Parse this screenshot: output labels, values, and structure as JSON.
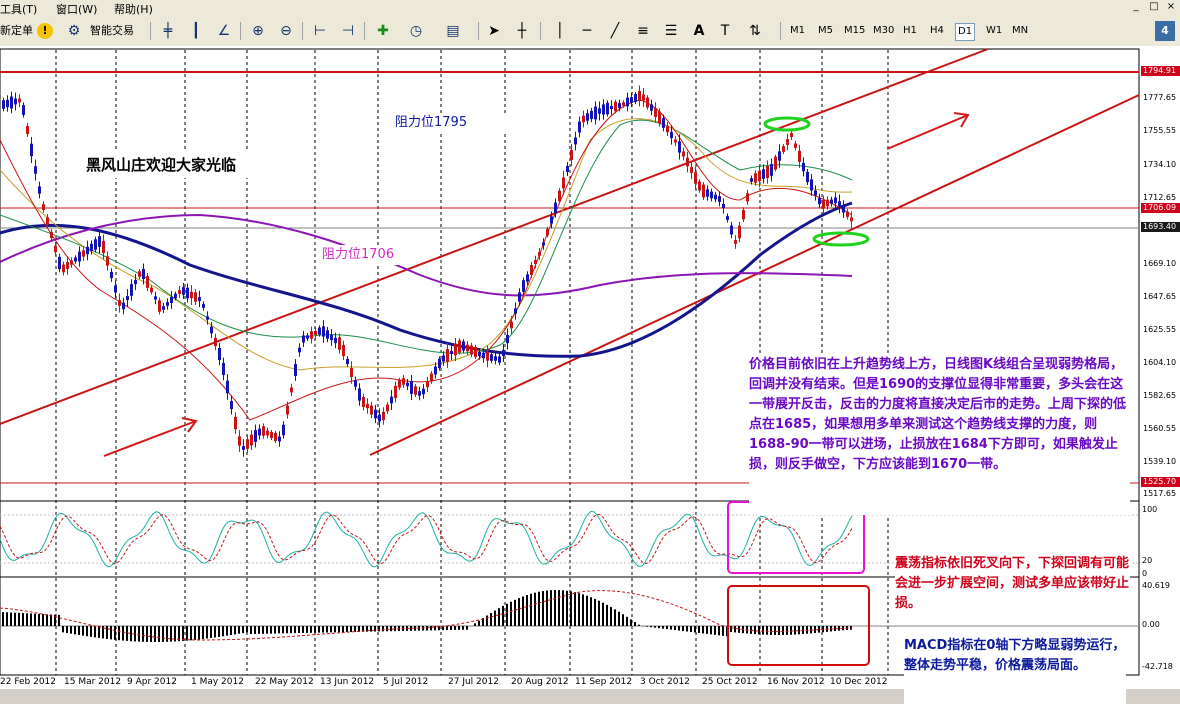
{
  "menu": {
    "items": [
      "工具(T)",
      "窗口(W)",
      "帮助(H)"
    ],
    "window_controls": [
      "_",
      "□",
      "×"
    ]
  },
  "toolbar": {
    "new_order": "新定单",
    "smart_trading": "智能交易",
    "timeframes": [
      "M1",
      "M5",
      "M15",
      "M30",
      "H1",
      "H4",
      "D1",
      "W1",
      "MN"
    ],
    "active_timeframe": "D1",
    "badge": "4"
  },
  "chart": {
    "welcome_text": "黑风山庄欢迎大家光临",
    "resistance_1795": "阻力位1795",
    "resistance_1706": "阻力位1706",
    "annotation_main": "价格目前依旧在上升趋势线上方，日线图K线组合呈现弱势格局，回调并没有结束。但是1690的支撑位显得非常重要，多头会在这一带展开反击，反击的力度将直接决定后市的走势。上周下探的低点在1685，如果想用多单来测试这个趋势线支撑的力度，则1688-90一带可以进场，止损放在1684下方即可，如果触发止损，则反手做空，下方应该能到1670一带。",
    "annotation_osc": "震荡指标依旧死叉向下，下探回调有可能会进一步扩展空间，测试多单应该带好止损。",
    "annotation_macd": "MACD指标在0轴下方略显弱势运行，整体走势平稳，价格震荡局面。",
    "price_axis": [
      "1794.91",
      "1777.65",
      "1755.55",
      "1734.10",
      "1712.65",
      "1706.09",
      "1693.40",
      "1669.10",
      "1647.65",
      "1625.55",
      "1604.10",
      "1582.65",
      "1560.55",
      "1539.10",
      "1525.70",
      "1517.65"
    ],
    "highlighted_prices": {
      "1794.91": "#d0021b",
      "1706.09": "#d0021b",
      "1693.40": "#1a1a1a",
      "1525.70": "#d0021b"
    },
    "osc_axis": [
      "100",
      "20",
      "0"
    ],
    "macd_axis": [
      "40.619",
      "0.00",
      "-42.718"
    ],
    "dates": [
      "22 Feb 2012",
      "15 Mar 2012",
      "9 Apr 2012",
      "1 May 2012",
      "22 May 2012",
      "13 Jun 2012",
      "5 Jul 2012",
      "27 Jul 2012",
      "20 Aug 2012",
      "11 Sep 2012",
      "3 Oct 2012",
      "25 Oct 2012",
      "16 Nov 2012",
      "10 Dec 2012"
    ]
  },
  "colors": {
    "resistance_line": "#c81414",
    "trendline": "#c81414",
    "ma_blue": "#14148c",
    "ma_purple": "#8c14b4",
    "ellipse_green": "#1ed21e",
    "box_magenta": "#e614d2",
    "box_red": "#d20a0a"
  }
}
